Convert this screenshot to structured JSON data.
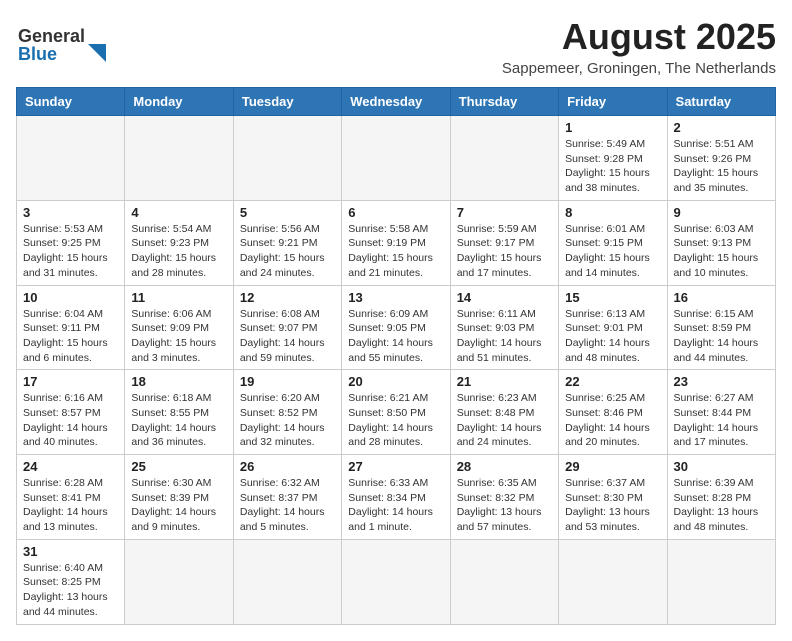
{
  "header": {
    "logo_general": "General",
    "logo_blue": "Blue",
    "month_title": "August 2025",
    "subtitle": "Sappemeer, Groningen, The Netherlands"
  },
  "weekdays": [
    "Sunday",
    "Monday",
    "Tuesday",
    "Wednesday",
    "Thursday",
    "Friday",
    "Saturday"
  ],
  "weeks": [
    [
      {
        "day": "",
        "info": ""
      },
      {
        "day": "",
        "info": ""
      },
      {
        "day": "",
        "info": ""
      },
      {
        "day": "",
        "info": ""
      },
      {
        "day": "",
        "info": ""
      },
      {
        "day": "1",
        "info": "Sunrise: 5:49 AM\nSunset: 9:28 PM\nDaylight: 15 hours and 38 minutes."
      },
      {
        "day": "2",
        "info": "Sunrise: 5:51 AM\nSunset: 9:26 PM\nDaylight: 15 hours and 35 minutes."
      }
    ],
    [
      {
        "day": "3",
        "info": "Sunrise: 5:53 AM\nSunset: 9:25 PM\nDaylight: 15 hours and 31 minutes."
      },
      {
        "day": "4",
        "info": "Sunrise: 5:54 AM\nSunset: 9:23 PM\nDaylight: 15 hours and 28 minutes."
      },
      {
        "day": "5",
        "info": "Sunrise: 5:56 AM\nSunset: 9:21 PM\nDaylight: 15 hours and 24 minutes."
      },
      {
        "day": "6",
        "info": "Sunrise: 5:58 AM\nSunset: 9:19 PM\nDaylight: 15 hours and 21 minutes."
      },
      {
        "day": "7",
        "info": "Sunrise: 5:59 AM\nSunset: 9:17 PM\nDaylight: 15 hours and 17 minutes."
      },
      {
        "day": "8",
        "info": "Sunrise: 6:01 AM\nSunset: 9:15 PM\nDaylight: 15 hours and 14 minutes."
      },
      {
        "day": "9",
        "info": "Sunrise: 6:03 AM\nSunset: 9:13 PM\nDaylight: 15 hours and 10 minutes."
      }
    ],
    [
      {
        "day": "10",
        "info": "Sunrise: 6:04 AM\nSunset: 9:11 PM\nDaylight: 15 hours and 6 minutes."
      },
      {
        "day": "11",
        "info": "Sunrise: 6:06 AM\nSunset: 9:09 PM\nDaylight: 15 hours and 3 minutes."
      },
      {
        "day": "12",
        "info": "Sunrise: 6:08 AM\nSunset: 9:07 PM\nDaylight: 14 hours and 59 minutes."
      },
      {
        "day": "13",
        "info": "Sunrise: 6:09 AM\nSunset: 9:05 PM\nDaylight: 14 hours and 55 minutes."
      },
      {
        "day": "14",
        "info": "Sunrise: 6:11 AM\nSunset: 9:03 PM\nDaylight: 14 hours and 51 minutes."
      },
      {
        "day": "15",
        "info": "Sunrise: 6:13 AM\nSunset: 9:01 PM\nDaylight: 14 hours and 48 minutes."
      },
      {
        "day": "16",
        "info": "Sunrise: 6:15 AM\nSunset: 8:59 PM\nDaylight: 14 hours and 44 minutes."
      }
    ],
    [
      {
        "day": "17",
        "info": "Sunrise: 6:16 AM\nSunset: 8:57 PM\nDaylight: 14 hours and 40 minutes."
      },
      {
        "day": "18",
        "info": "Sunrise: 6:18 AM\nSunset: 8:55 PM\nDaylight: 14 hours and 36 minutes."
      },
      {
        "day": "19",
        "info": "Sunrise: 6:20 AM\nSunset: 8:52 PM\nDaylight: 14 hours and 32 minutes."
      },
      {
        "day": "20",
        "info": "Sunrise: 6:21 AM\nSunset: 8:50 PM\nDaylight: 14 hours and 28 minutes."
      },
      {
        "day": "21",
        "info": "Sunrise: 6:23 AM\nSunset: 8:48 PM\nDaylight: 14 hours and 24 minutes."
      },
      {
        "day": "22",
        "info": "Sunrise: 6:25 AM\nSunset: 8:46 PM\nDaylight: 14 hours and 20 minutes."
      },
      {
        "day": "23",
        "info": "Sunrise: 6:27 AM\nSunset: 8:44 PM\nDaylight: 14 hours and 17 minutes."
      }
    ],
    [
      {
        "day": "24",
        "info": "Sunrise: 6:28 AM\nSunset: 8:41 PM\nDaylight: 14 hours and 13 minutes."
      },
      {
        "day": "25",
        "info": "Sunrise: 6:30 AM\nSunset: 8:39 PM\nDaylight: 14 hours and 9 minutes."
      },
      {
        "day": "26",
        "info": "Sunrise: 6:32 AM\nSunset: 8:37 PM\nDaylight: 14 hours and 5 minutes."
      },
      {
        "day": "27",
        "info": "Sunrise: 6:33 AM\nSunset: 8:34 PM\nDaylight: 14 hours and 1 minute."
      },
      {
        "day": "28",
        "info": "Sunrise: 6:35 AM\nSunset: 8:32 PM\nDaylight: 13 hours and 57 minutes."
      },
      {
        "day": "29",
        "info": "Sunrise: 6:37 AM\nSunset: 8:30 PM\nDaylight: 13 hours and 53 minutes."
      },
      {
        "day": "30",
        "info": "Sunrise: 6:39 AM\nSunset: 8:28 PM\nDaylight: 13 hours and 48 minutes."
      }
    ],
    [
      {
        "day": "31",
        "info": "Sunrise: 6:40 AM\nSunset: 8:25 PM\nDaylight: 13 hours and 44 minutes."
      },
      {
        "day": "",
        "info": ""
      },
      {
        "day": "",
        "info": ""
      },
      {
        "day": "",
        "info": ""
      },
      {
        "day": "",
        "info": ""
      },
      {
        "day": "",
        "info": ""
      },
      {
        "day": "",
        "info": ""
      }
    ]
  ]
}
